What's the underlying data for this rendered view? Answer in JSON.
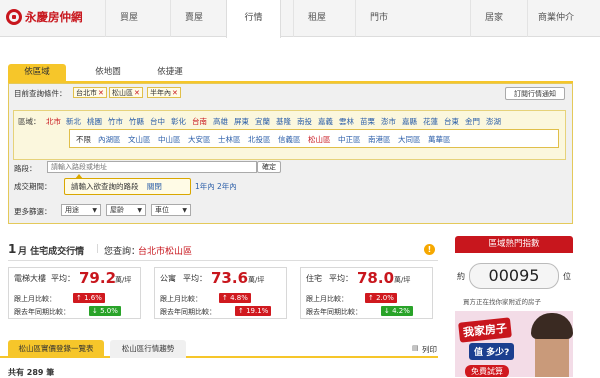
{
  "brand": {
    "name": "永慶房仲網"
  },
  "nav": {
    "items": [
      "買屋",
      "賣屋",
      "行情",
      "租屋",
      "門市",
      "居家",
      "商業仲介"
    ]
  },
  "search_tabs": [
    "依區域",
    "依地圖",
    "依捷運"
  ],
  "criteria": {
    "label": "目前查詢條件：",
    "tags": [
      "台北市",
      "松山區",
      "半年內"
    ],
    "remove_glyph": "✕",
    "subscribe_button": "訂閱行情通知"
  },
  "area": {
    "label": "區域：",
    "cities": [
      "北市",
      "新北",
      "桃園",
      "竹市",
      "竹縣",
      "台中",
      "彰化",
      "台南",
      "高雄",
      "屏東",
      "宜蘭",
      "基隆",
      "南投",
      "嘉義",
      "雲林",
      "苗栗",
      "澎市",
      "嘉縣",
      "花蓮",
      "台東",
      "金門",
      "澎湖"
    ],
    "districts": [
      "不限",
      "內湖區",
      "文山區",
      "中山區",
      "大安區",
      "士林區",
      "北投區",
      "信義區",
      "松山區",
      "中正區",
      "南港區",
      "大同區",
      "萬華區"
    ]
  },
  "road": {
    "label": "路段：",
    "placeholder": "請輸入路段或地址",
    "confirm": "確定"
  },
  "period": {
    "label": "成交期間：",
    "tooltip": "請輸入欲查詢的路段",
    "close": "關閉",
    "options": [
      "1年內",
      "2年內"
    ]
  },
  "more": {
    "label": "更多篩選：",
    "selects": [
      "用途",
      "屋齡",
      "車位"
    ]
  },
  "trend": {
    "month": "1",
    "title_suffix": "月 住宅成交行情",
    "query_label": "您查詢：",
    "query_value": "台北市松山區",
    "cards": [
      {
        "name": "電梯大樓",
        "price_label": "平均：",
        "price": "79.2",
        "unit": "萬/坪",
        "mom_label": "跟上月比較：",
        "mom": "↑ 1.6%",
        "mom_dir": "up",
        "yoy_label": "跟去年同期比較：",
        "yoy": "↓ 5.0%",
        "yoy_dir": "down"
      },
      {
        "name": "公寓",
        "price_label": "平均：",
        "price": "73.6",
        "unit": "萬/坪",
        "mom_label": "跟上月比較：",
        "mom": "↑ 4.8%",
        "mom_dir": "up",
        "yoy_label": "跟去年同期比較：",
        "yoy": "↑ 19.1%",
        "yoy_dir": "up"
      },
      {
        "name": "住宅",
        "price_label": "平均：",
        "price": "78.0",
        "unit": "萬/坪",
        "mom_label": "跟上月比較：",
        "mom": "↑ 2.0%",
        "mom_dir": "up",
        "yoy_label": "跟去年同期比較：",
        "yoy": "↓ 4.2%",
        "yoy_dir": "down"
      }
    ]
  },
  "side": {
    "title": "區域熱門指數",
    "counter": "00095",
    "left": "約",
    "right": "位",
    "caption": "買方正在找你家附近的房子",
    "ad_line1": "我家房子",
    "ad_line2": "值 多少?",
    "ad_line3": "免費試算"
  },
  "bottom": {
    "tabs": [
      "松山區實價登錄一覽表",
      "松山區行情趨勢"
    ],
    "print": "列印",
    "total": "共有 289 筆"
  },
  "colors": {
    "brand_red": "#c8161d",
    "accent_yellow": "#f6c62a"
  }
}
